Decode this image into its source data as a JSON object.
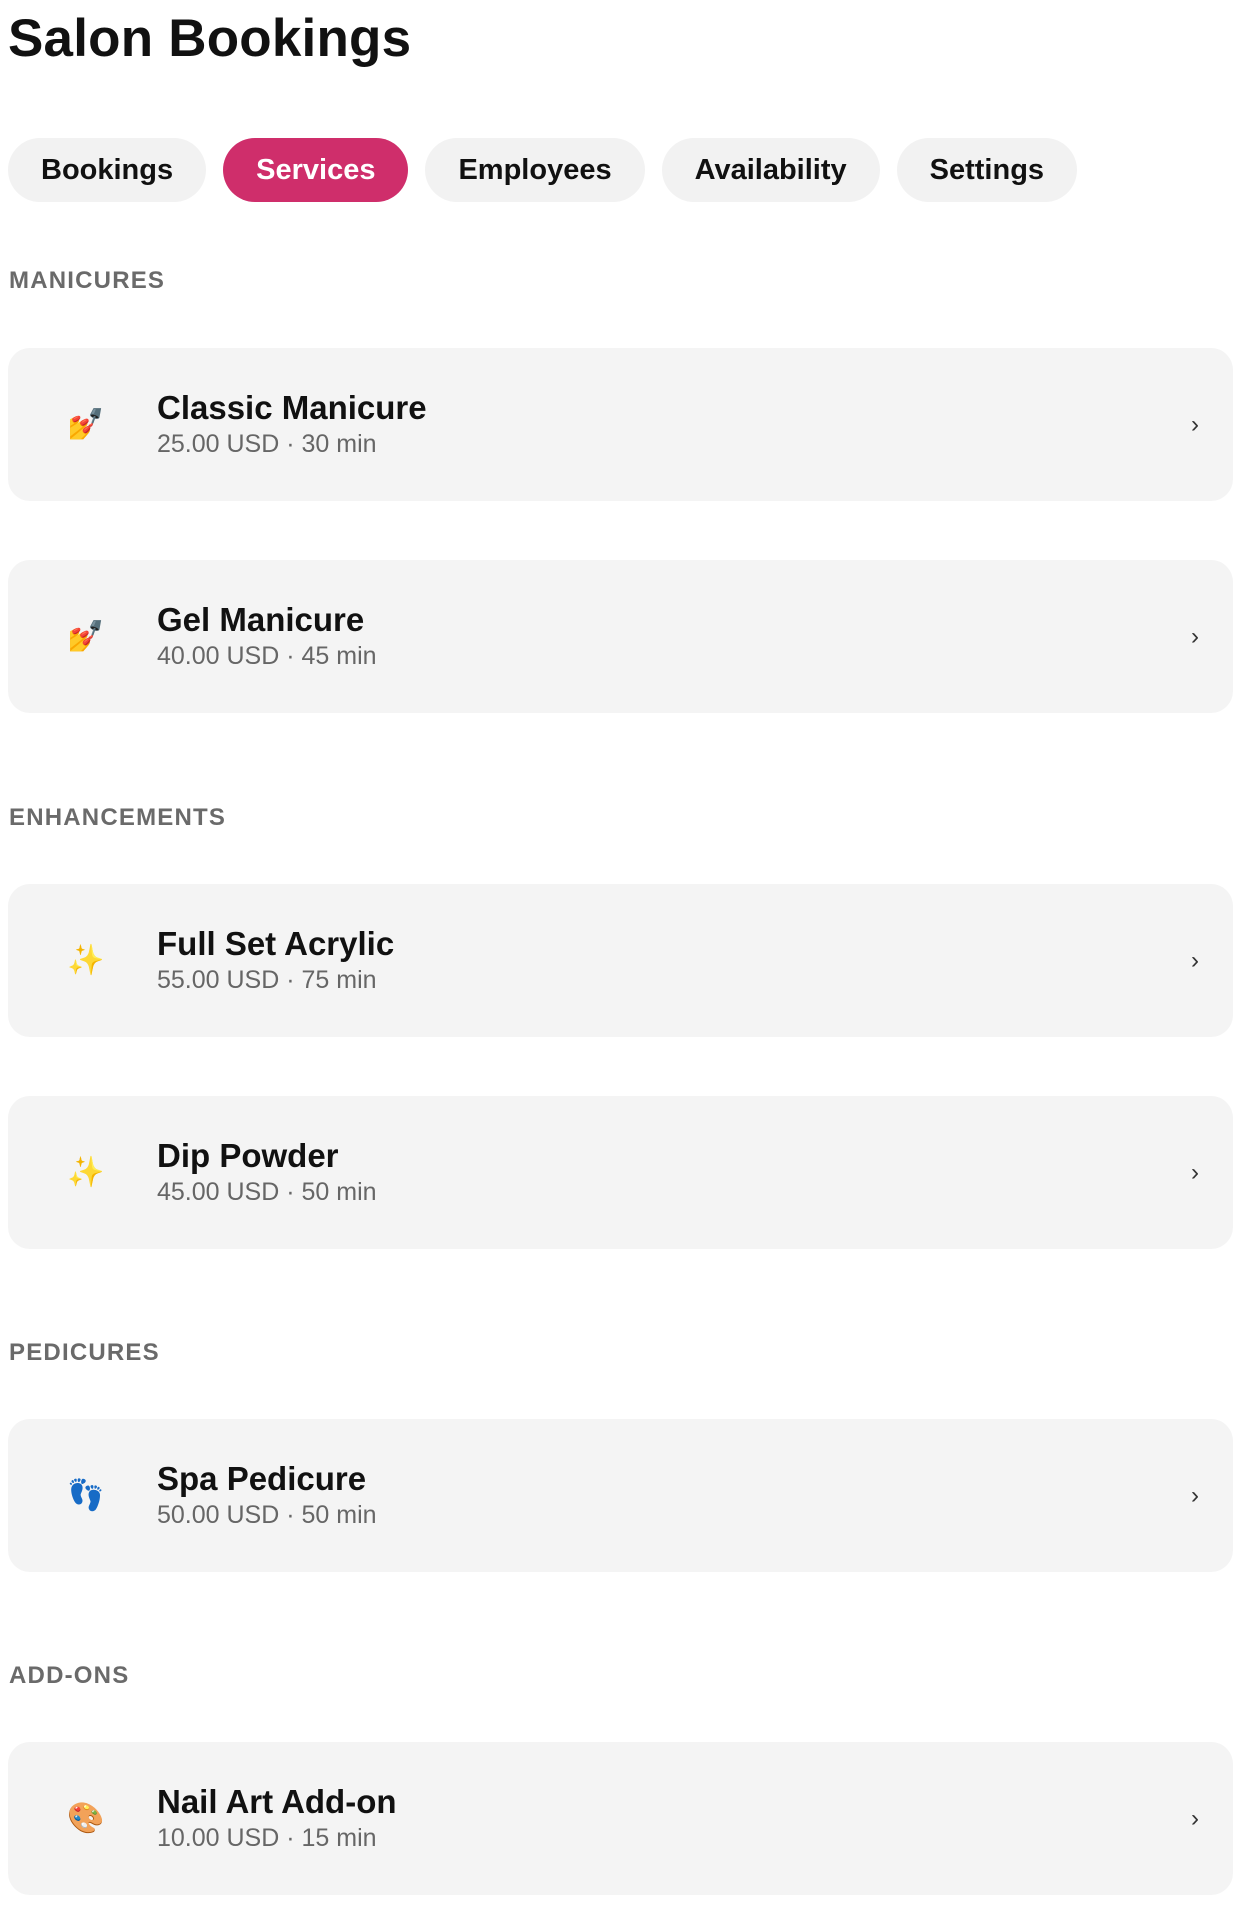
{
  "header": {
    "title": "Salon Bookings"
  },
  "tabs": [
    {
      "label": "Bookings",
      "active": false
    },
    {
      "label": "Services",
      "active": true
    },
    {
      "label": "Employees",
      "active": false
    },
    {
      "label": "Availability",
      "active": false
    },
    {
      "label": "Settings",
      "active": false
    }
  ],
  "colors": {
    "accent": "#cf2e6b",
    "card_bg": "#f4f4f4",
    "tab_bg": "#f2f2f2",
    "section_header": "#6a6a6a"
  },
  "sections": [
    {
      "title": "MANICURES",
      "services": [
        {
          "name": "Classic Manicure",
          "meta": "25.00 USD · 30 min",
          "icon": "nail-polish-icon",
          "glyph": "💅"
        },
        {
          "name": "Gel Manicure",
          "meta": "40.00 USD · 45 min",
          "icon": "nail-polish-icon",
          "glyph": "💅"
        }
      ]
    },
    {
      "title": "ENHANCEMENTS",
      "services": [
        {
          "name": "Full Set Acrylic",
          "meta": "55.00 USD · 75 min",
          "icon": "sparkles-icon",
          "glyph": "✨"
        },
        {
          "name": "Dip Powder",
          "meta": "45.00 USD · 50 min",
          "icon": "sparkles-icon",
          "glyph": "✨"
        }
      ]
    },
    {
      "title": "PEDICURES",
      "services": [
        {
          "name": "Spa Pedicure",
          "meta": "50.00 USD · 50 min",
          "icon": "footprint-icon",
          "glyph": "👣"
        }
      ]
    },
    {
      "title": "ADD-ONS",
      "services": [
        {
          "name": "Nail Art Add-on",
          "meta": "10.00 USD · 15 min",
          "icon": "palette-icon",
          "glyph": "🎨"
        }
      ]
    }
  ],
  "chevron_glyph": "›"
}
